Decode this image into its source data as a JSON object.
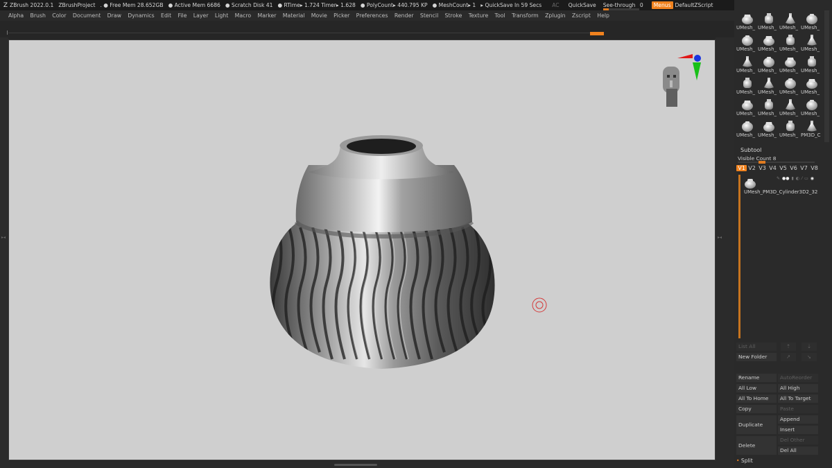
{
  "titlebar": {
    "app": "ZBrush 2022.0.1",
    "project": "ZBrushProject",
    "stats": [
      ". ● Free Mem 28.652GB",
      "● Active Mem 6686",
      "● Scratch Disk 41",
      "● RTime▸ 1.724 Timer▸ 1.628",
      "● PolyCount▸ 440.795 KP",
      "● MeshCount▸ 1",
      "▸ QuickSave In 59 Secs"
    ],
    "ac": "AC",
    "quicksave": "QuickSave",
    "seethrough": "See-through",
    "seethrough_value": "0",
    "seethrough_level": 0.0,
    "menus": "Menus",
    "script": "DefaultZScript"
  },
  "menubar": [
    "Alpha",
    "Brush",
    "Color",
    "Document",
    "Draw",
    "Dynamics",
    "Edit",
    "File",
    "Layer",
    "Light",
    "Macro",
    "Marker",
    "Material",
    "Movie",
    "Picker",
    "Preferences",
    "Render",
    "Stencil",
    "Stroke",
    "Texture",
    "Tool",
    "Transform",
    "Zplugin",
    "Zscript",
    "Help"
  ],
  "thumbnails": {
    "labels": [
      "UMesh_",
      "UMesh_",
      "UMesh_",
      "UMesh_",
      "UMesh_",
      "UMesh_",
      "UMesh_",
      "UMesh_",
      "UMesh_",
      "UMesh_",
      "UMesh_",
      "UMesh_",
      "UMesh_",
      "UMesh_",
      "UMesh_",
      "UMesh_",
      "UMesh_",
      "UMesh_",
      "UMesh_",
      "UMesh_",
      "UMesh_",
      "UMesh_",
      "UMesh_",
      "PM3D_C"
    ]
  },
  "subtool": {
    "title": "Subtool",
    "visible_count": "Visible Count 8",
    "visible_level": 0.3,
    "tabs": [
      "V1",
      "V2",
      "V3",
      "V4",
      "V5",
      "V6",
      "V7",
      "V8"
    ],
    "active_tab": "V1",
    "item_name": "UMesh_PM3D_Cylinder3D2_32",
    "buttons": {
      "list_all": "List All",
      "new_folder": "New Folder",
      "rename": "Rename",
      "autoreorder": "AutoReorder",
      "all_low": "All Low",
      "all_high": "All High",
      "all_to_home": "All To Home",
      "all_to_target": "All To Target",
      "copy": "Copy",
      "paste": "Paste",
      "duplicate": "Duplicate",
      "append": "Append",
      "insert": "Insert",
      "delete": "Delete",
      "del_other": "Del Other",
      "del_all": "Del All"
    },
    "split": "Split"
  },
  "colors": {
    "accent": "#f0821e",
    "viewport_bg": "#cfcfcf",
    "panel_bg": "#2a2a2a"
  }
}
